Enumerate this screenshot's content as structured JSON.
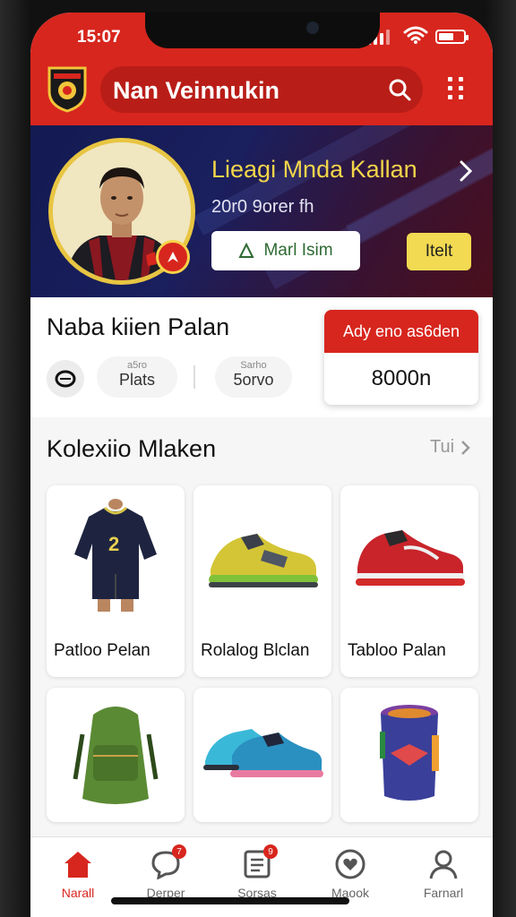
{
  "status": {
    "time": "15:07"
  },
  "app": {
    "title": "Nan Veinnukin"
  },
  "banner": {
    "player_name": "Lieagi Mnda Kallan",
    "subtitle": "20r0 9orer fh",
    "btn_outline": "Marl Isim",
    "btn_yellow": "Itelt"
  },
  "profile": {
    "title": "Naba kiien Palan",
    "stat1": {
      "small": "a5ro",
      "big": "Plats"
    },
    "stat2": {
      "small": "Sarho",
      "big": "5orvo"
    },
    "points_head": "Ady eno as6den",
    "points_value": "8000n"
  },
  "collection": {
    "title": "Kolexiio Mlaken",
    "see_all": "Tui",
    "items": [
      {
        "label": "Patloo Pelan",
        "icon": "jersey-icon"
      },
      {
        "label": "Rolalog Blclan",
        "icon": "shoe-icon"
      },
      {
        "label": "Tabloo Palan",
        "icon": "shoe-icon"
      },
      {
        "label": "",
        "icon": "backpack-icon"
      },
      {
        "label": "",
        "icon": "shoe-icon"
      },
      {
        "label": "",
        "icon": "bag-icon"
      }
    ]
  },
  "tabs": [
    {
      "label": "Narall",
      "icon": "home-icon",
      "active": true
    },
    {
      "label": "Derper",
      "icon": "chat-icon",
      "badge": "7"
    },
    {
      "label": "Sorsas",
      "icon": "list-icon",
      "badge": "9"
    },
    {
      "label": "Maook",
      "icon": "heart-icon"
    },
    {
      "label": "Farnarl",
      "icon": "user-icon"
    }
  ],
  "colors": {
    "primary": "#d7261e",
    "accent": "#f2da52",
    "banner": "#131a52"
  }
}
